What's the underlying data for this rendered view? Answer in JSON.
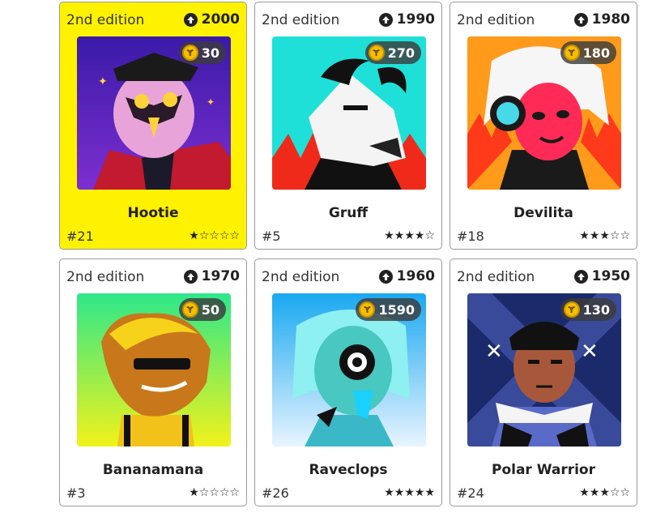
{
  "cards": [
    {
      "edition": "2nd edition",
      "score": "2000",
      "coin": "30",
      "name": "Hootie",
      "num": "#21",
      "stars": "★☆☆☆☆",
      "selected": true
    },
    {
      "edition": "2nd edition",
      "score": "1990",
      "coin": "270",
      "name": "Gruff",
      "num": "#5",
      "stars": "★★★★☆",
      "selected": false
    },
    {
      "edition": "2nd edition",
      "score": "1980",
      "coin": "180",
      "name": "Devilita",
      "num": "#18",
      "stars": "★★★☆☆",
      "selected": false
    },
    {
      "edition": "2nd edition",
      "score": "1970",
      "coin": "50",
      "name": "Bananamana",
      "num": "#3",
      "stars": "★☆☆☆☆",
      "selected": false
    },
    {
      "edition": "2nd edition",
      "score": "1960",
      "coin": "1590",
      "name": "Raveclops",
      "num": "#26",
      "stars": "★★★★★",
      "selected": false
    },
    {
      "edition": "2nd edition",
      "score": "1950",
      "coin": "130",
      "name": "Polar Warrior",
      "num": "#24",
      "stars": "★★★☆☆",
      "selected": false
    }
  ],
  "coin_glyph": "Ɏ",
  "colors": {
    "selected": "#fff200",
    "border": "#9a9a9a"
  }
}
